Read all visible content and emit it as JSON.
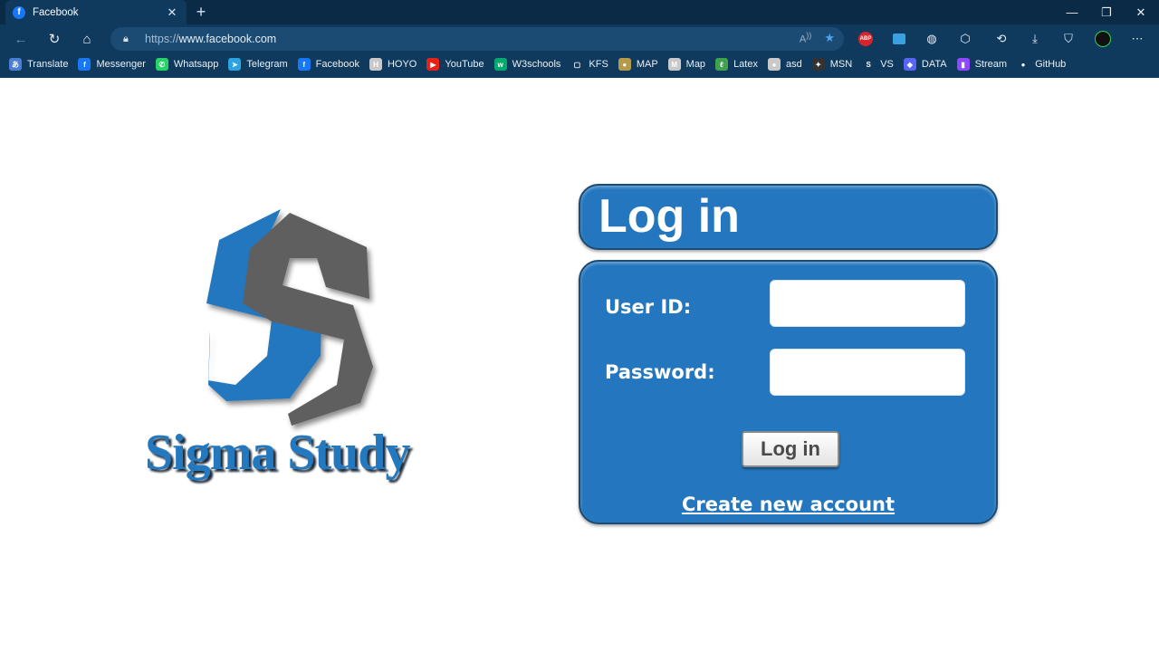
{
  "browser": {
    "tab_title": "Facebook",
    "tab_icon": "facebook-icon",
    "url_protocol": "https://",
    "url_host": "www.facebook.com",
    "bookmarks": [
      {
        "label": "Translate",
        "icon": "translate-icon",
        "color": "#4a7fd6"
      },
      {
        "label": "Messenger",
        "icon": "facebook-icon",
        "color": "#1877f2"
      },
      {
        "label": "Whatsapp",
        "icon": "whatsapp-icon",
        "color": "#25d366"
      },
      {
        "label": "Telegram",
        "icon": "telegram-icon",
        "color": "#2aa3e0"
      },
      {
        "label": "Facebook",
        "icon": "facebook-icon",
        "color": "#1877f2"
      },
      {
        "label": "HOYO",
        "icon": "hoyo-icon",
        "color": "#c9c9c9"
      },
      {
        "label": "YouTube",
        "icon": "youtube-icon",
        "color": "#e62117"
      },
      {
        "label": "W3schools",
        "icon": "w3schools-icon",
        "color": "#04aa6d"
      },
      {
        "label": "KFS",
        "icon": "file-icon",
        "color": "#0f3a5e"
      },
      {
        "label": "MAP",
        "icon": "globe-icon",
        "color": "#b59a4a"
      },
      {
        "label": "Map",
        "icon": "map-icon",
        "color": "#c9c9c9"
      },
      {
        "label": "Latex",
        "icon": "latex-icon",
        "color": "#3fa34d"
      },
      {
        "label": "asd",
        "icon": "asd-icon",
        "color": "#c9c9c9"
      },
      {
        "label": "MSN",
        "icon": "msn-icon",
        "color": "#333333"
      },
      {
        "label": "VS",
        "icon": "vs-icon",
        "color": "#0f3a5e"
      },
      {
        "label": "DATA",
        "icon": "data-icon",
        "color": "#5865f2"
      },
      {
        "label": "Stream",
        "icon": "twitch-icon",
        "color": "#9146ff"
      },
      {
        "label": "GitHub",
        "icon": "github-icon",
        "color": "#0f3a5e"
      }
    ]
  },
  "page": {
    "brand": "Sigma Study",
    "login_title": "Log in",
    "user_id_label": "User ID:",
    "user_id_value": "",
    "password_label": "Password:",
    "password_value": "",
    "login_button": "Log in",
    "create_account": "Create new account",
    "accent_color": "#2477be",
    "logo_gray": "#5f5f5f"
  }
}
